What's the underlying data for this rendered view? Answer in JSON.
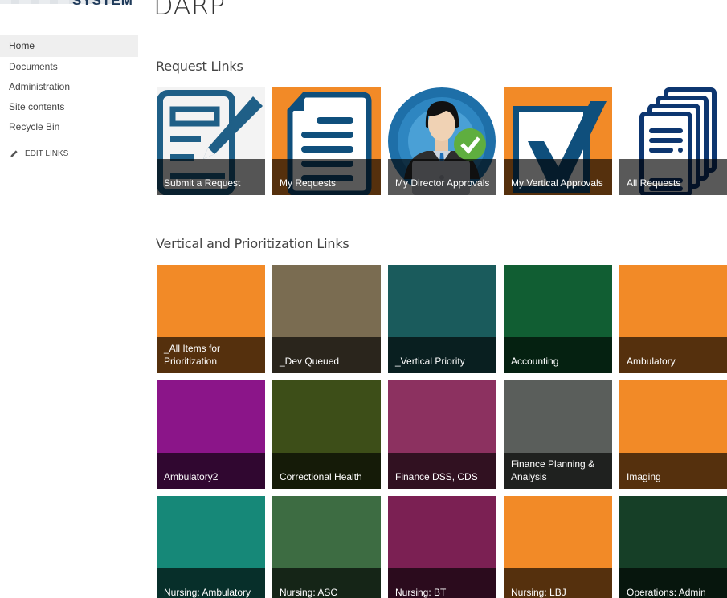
{
  "logo": {
    "text": "SYSTEM"
  },
  "page": {
    "title": "DARP"
  },
  "sidebar": {
    "items": [
      {
        "label": "Home",
        "selected": true
      },
      {
        "label": "Documents"
      },
      {
        "label": "Administration"
      },
      {
        "label": "Site contents"
      },
      {
        "label": "Recycle Bin"
      }
    ],
    "edit_links": {
      "label": "EDIT LINKS",
      "icon": "pencil-icon"
    }
  },
  "request_links": {
    "heading": "Request Links",
    "tiles": [
      {
        "label": "Submit a Request",
        "icon": "form-edit-icon",
        "bg": "#f3f3f3"
      },
      {
        "label": "My Requests",
        "icon": "document-icon",
        "bg": "#f28a27"
      },
      {
        "label": "My Director Approvals",
        "icon": "director-approval-icon",
        "bg": "#ffffff"
      },
      {
        "label": "My Vertical Approvals",
        "icon": "checkbox-check-icon",
        "bg": "#f28a27"
      },
      {
        "label": "All Requests",
        "icon": "document-stack-icon",
        "bg": "#ffffff"
      }
    ]
  },
  "vertical_links": {
    "heading": "Vertical and Prioritization Links",
    "tiles": [
      {
        "label": "_All Items for Prioritization",
        "color": "#f28a27"
      },
      {
        "label": "_Dev Queued",
        "color": "#7a6c51"
      },
      {
        "label": "_Vertical Priority",
        "color": "#1a5b5c"
      },
      {
        "label": "Accounting",
        "color": "#115e33"
      },
      {
        "label": "Ambulatory",
        "color": "#f28a27"
      },
      {
        "label": "Ambulatory2",
        "color": "#8b1589"
      },
      {
        "label": "Correctional Health",
        "color": "#3d4e18"
      },
      {
        "label": "Finance DSS, CDS",
        "color": "#8c3160"
      },
      {
        "label": "Finance Planning & Analysis",
        "color": "#5a5e5b"
      },
      {
        "label": "Imaging",
        "color": "#f28a27"
      },
      {
        "label": "Nursing: Ambulatory",
        "color": "#168878"
      },
      {
        "label": "Nursing: ASC",
        "color": "#3d6c42"
      },
      {
        "label": "Nursing: BT",
        "color": "#7b2053"
      },
      {
        "label": "Nursing: LBJ",
        "color": "#f28a27"
      },
      {
        "label": "Operations: Admin",
        "color": "#163f27"
      }
    ]
  }
}
